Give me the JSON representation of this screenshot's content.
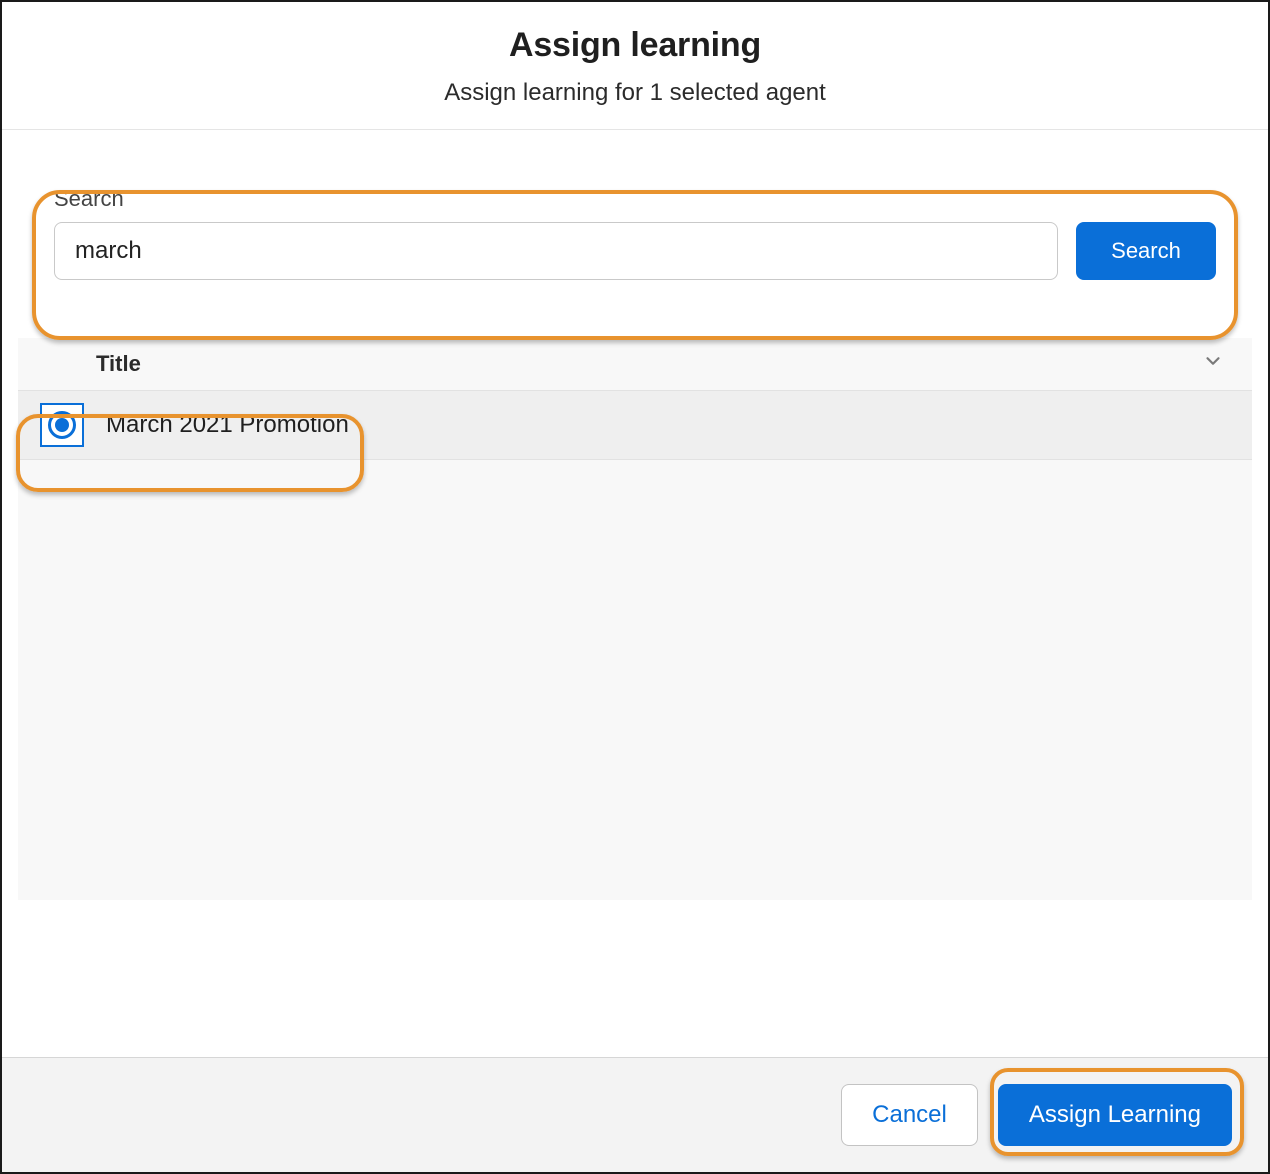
{
  "header": {
    "title": "Assign learning",
    "subtitle": "Assign learning for 1 selected agent"
  },
  "search": {
    "label": "Search",
    "value": "march",
    "button_label": "Search"
  },
  "results": {
    "column_title": "Title",
    "rows": [
      {
        "title": "March 2021 Promotion",
        "selected": true
      }
    ]
  },
  "footer": {
    "cancel_label": "Cancel",
    "assign_label": "Assign Learning"
  },
  "colors": {
    "primary": "#0a6fd8",
    "highlight": "#e8932e"
  }
}
